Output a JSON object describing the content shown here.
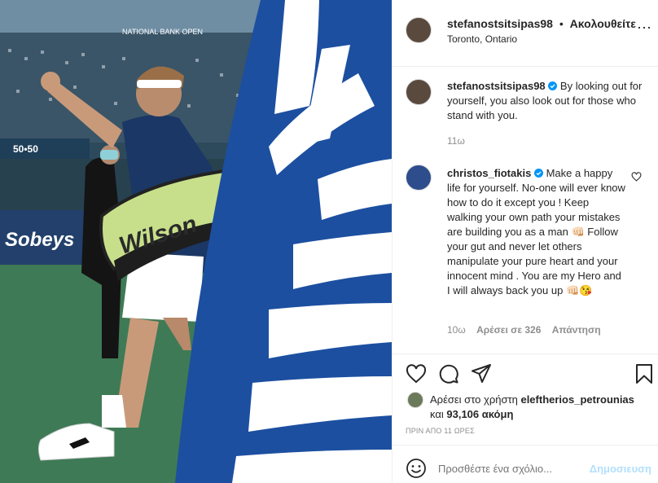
{
  "header": {
    "username": "stefanostsitsipas98",
    "separator": "•",
    "follow_label": "Ακολουθείτε",
    "location": "Toronto, Ontario",
    "more_label": "⋯"
  },
  "caption": {
    "username": "stefanostsitsipas98",
    "text": "By looking out for yourself, you also look out for those who stand with you.",
    "time": "11ω"
  },
  "comment": {
    "username": "christos_fiotakis",
    "text": "Make a happy life for yourself. No-one will ever know how to do it except you ! Keep walking your own path your mistakes are building you as a man 👊🏻 Follow your gut and never let others manipulate your pure heart and your innocent mind . You are my Hero and I will always back you up 👊🏻😘",
    "time": "10ω",
    "likes": "Αρέσει σε 326",
    "reply_label": "Απάντηση"
  },
  "likes": {
    "prefix": "Αρέσει στο χρήστη",
    "user": "eleftherios_petrounias",
    "and": "και",
    "count": "93,106 ακόμη"
  },
  "timestamp": "ΠΡΙΝ ΑΠΟ 11 ΩΡΕΣ",
  "add_comment": {
    "placeholder": "Προσθέστε ένα σχόλιο...",
    "post_label": "Δημοσιευση"
  },
  "photo": {
    "bag_brand": "Wilson",
    "sponsor_sign": "Sobeys",
    "board_text": "50•50",
    "banner_text": "NATIONAL BANK OPEN"
  },
  "icons": {
    "heart": "heart-icon",
    "comment": "comment-icon",
    "share": "share-icon",
    "save": "bookmark-icon",
    "emoji": "emoji-icon",
    "verified": "verified-badge-icon",
    "more": "more-options-icon"
  },
  "colors": {
    "blue_link": "#0095f6",
    "verified": "#0095f6",
    "greek_blue": "#1c4fa0",
    "court_green": "#3f7a56"
  }
}
